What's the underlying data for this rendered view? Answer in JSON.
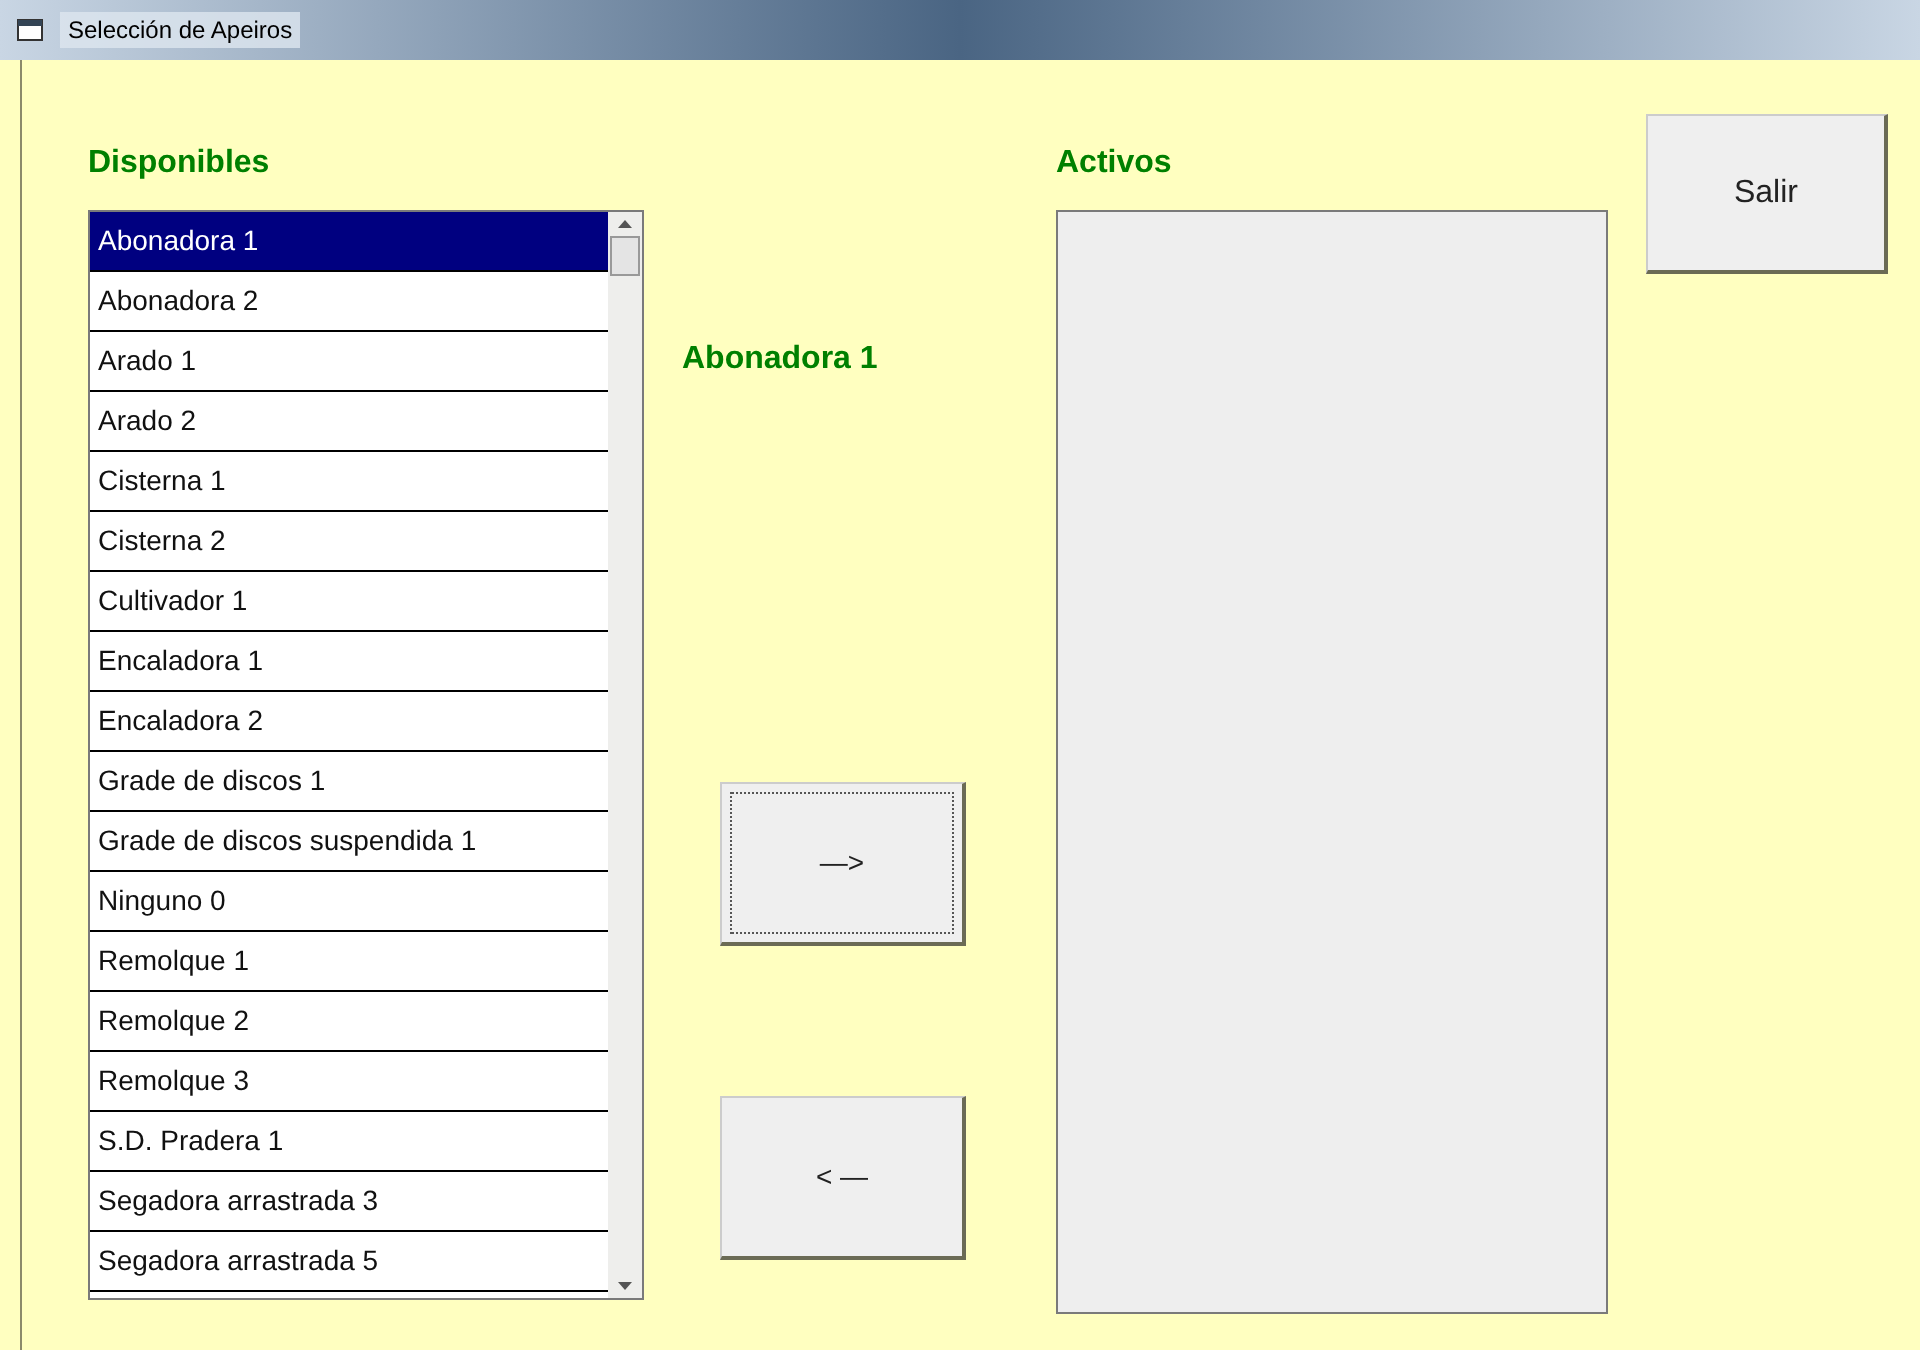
{
  "window": {
    "title": "Selección de Apeiros"
  },
  "available": {
    "label": "Disponibles",
    "items": [
      {
        "text": "Abonadora 1",
        "selected": true
      },
      {
        "text": "Abonadora 2",
        "selected": false
      },
      {
        "text": "Arado 1",
        "selected": false
      },
      {
        "text": "Arado 2",
        "selected": false
      },
      {
        "text": "Cisterna 1",
        "selected": false
      },
      {
        "text": "Cisterna 2",
        "selected": false
      },
      {
        "text": "Cultivador 1",
        "selected": false
      },
      {
        "text": "Encaladora 1",
        "selected": false
      },
      {
        "text": "Encaladora 2",
        "selected": false
      },
      {
        "text": "Grade de discos 1",
        "selected": false
      },
      {
        "text": "Grade de discos suspendida 1",
        "selected": false
      },
      {
        "text": "Ninguno 0",
        "selected": false
      },
      {
        "text": "Remolque 1",
        "selected": false
      },
      {
        "text": "Remolque 2",
        "selected": false
      },
      {
        "text": "Remolque 3",
        "selected": false
      },
      {
        "text": "S.D. Pradera 1",
        "selected": false
      },
      {
        "text": "Segadora arrastrada 3",
        "selected": false
      },
      {
        "text": "Segadora arrastrada 5",
        "selected": false
      }
    ]
  },
  "current_selection": "Abonadora 1",
  "buttons": [
    {
      "label": "—>",
      "focused": true
    },
    {
      "label": "< —",
      "focused": false
    }
  ],
  "active": {
    "label": "Activos"
  },
  "exit_button": {
    "label": "Salir"
  }
}
